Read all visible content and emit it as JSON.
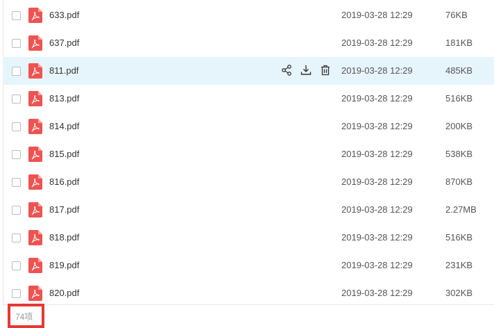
{
  "files": [
    {
      "name": "633.pdf",
      "date": "2019-03-28 12:29",
      "size": "76KB",
      "hover": false
    },
    {
      "name": "637.pdf",
      "date": "2019-03-28 12:29",
      "size": "181KB",
      "hover": false
    },
    {
      "name": "811.pdf",
      "date": "2019-03-28 12:29",
      "size": "485KB",
      "hover": true
    },
    {
      "name": "813.pdf",
      "date": "2019-03-28 12:29",
      "size": "516KB",
      "hover": false
    },
    {
      "name": "814.pdf",
      "date": "2019-03-28 12:29",
      "size": "200KB",
      "hover": false
    },
    {
      "name": "815.pdf",
      "date": "2019-03-28 12:29",
      "size": "538KB",
      "hover": false
    },
    {
      "name": "816.pdf",
      "date": "2019-03-28 12:29",
      "size": "870KB",
      "hover": false
    },
    {
      "name": "817.pdf",
      "date": "2019-03-28 12:29",
      "size": "2.27MB",
      "hover": false
    },
    {
      "name": "818.pdf",
      "date": "2019-03-28 12:29",
      "size": "516KB",
      "hover": false
    },
    {
      "name": "819.pdf",
      "date": "2019-03-28 12:29",
      "size": "231KB",
      "hover": false
    },
    {
      "name": "820.pdf",
      "date": "2019-03-28 12:29",
      "size": "302KB",
      "hover": false
    }
  ],
  "row_actions": [
    "share-icon",
    "download-icon",
    "delete-icon"
  ],
  "footer": {
    "count_label": "74项"
  },
  "colors": {
    "pdf_red": "#ef5350",
    "hover_bg": "#e6f4fc",
    "highlight_border": "#e53935"
  }
}
